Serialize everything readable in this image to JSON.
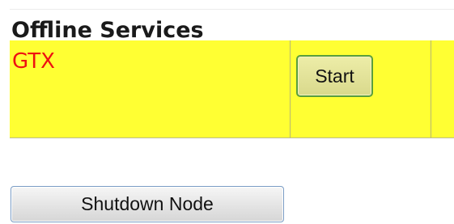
{
  "offline_services": {
    "title": "Offline Services",
    "services": [
      {
        "name": "GTX",
        "action_label": "Start",
        "row_color": "#ffff33",
        "name_color": "#ee1111"
      }
    ]
  },
  "node_actions": {
    "shutdown_label": "Shutdown Node"
  }
}
